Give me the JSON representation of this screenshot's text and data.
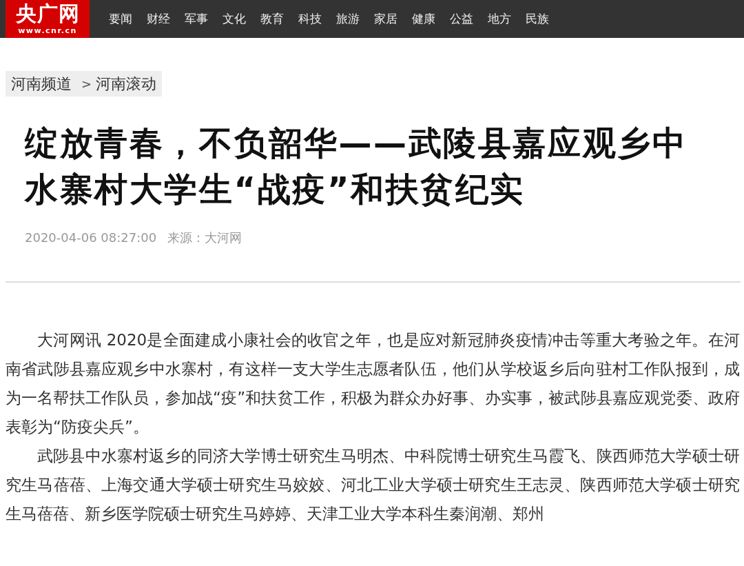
{
  "logo": {
    "title": "央广网",
    "url": "www.cnr.cn"
  },
  "nav": [
    "要闻",
    "财经",
    "军事",
    "文化",
    "教育",
    "科技",
    "旅游",
    "家居",
    "健康",
    "公益",
    "地方",
    "民族"
  ],
  "breadcrumb": [
    "河南频道",
    "河南滚动"
  ],
  "breadcrumb_separator": ">",
  "article": {
    "title": "绽放青春，不负韶华——武陵县嘉应观乡中水寨村大学生“战疫”和扶贫纪实",
    "date": "2020-04-06 08:27:00",
    "source_label": "来源：",
    "source": "大河网",
    "paragraphs": [
      "大河网讯 2020是全面建成小康社会的收官之年，也是应对新冠肺炎疫情冲击等重大考验之年。在河南省武陟县嘉应观乡中水寨村，有这样一支大学生志愿者队伍，他们从学校返乡后向驻村工作队报到，成为一名帮扶工作队员，参加战“疫”和扶贫工作，积极为群众办好事、办实事，被武陟县嘉应观党委、政府表彰为“防疫尖兵”。",
      "武陟县中水寨村返乡的同济大学博士研究生马明杰、中科院博士研究生马霞飞、陕西师范大学硕士研究生马蓓蓓、上海交通大学硕士研究生马姣姣、河北工业大学硕士研究生王志灵、陕西师范大学硕士研究生马蓓蓓、新乡医学院硕士研究生马婷婷、天津工业大学本科生秦润潮、郑州"
    ]
  }
}
